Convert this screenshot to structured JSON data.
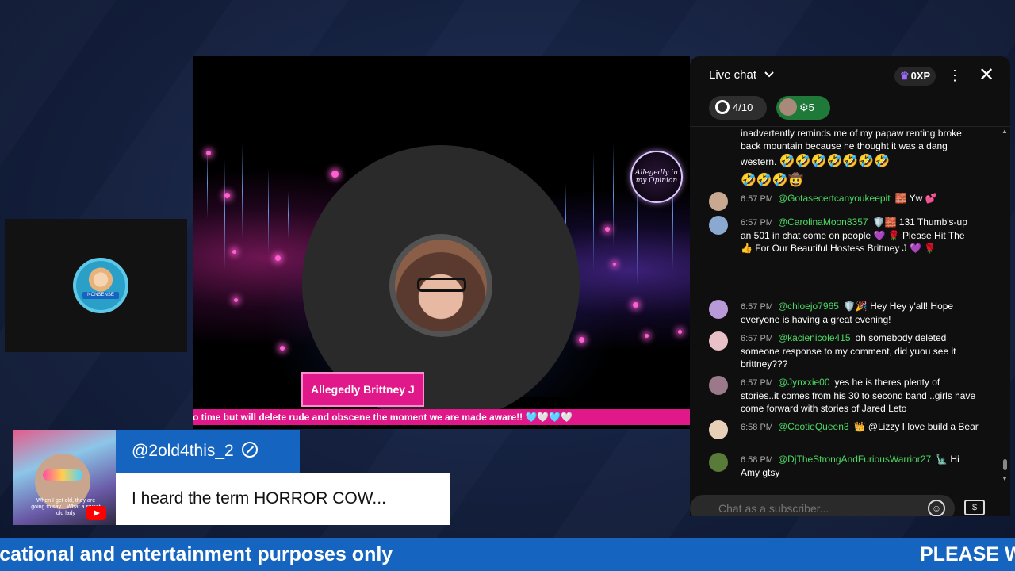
{
  "guest": {
    "avatar_label": "NONSENSE"
  },
  "stage": {
    "logo_text": "Allegedly in my Opinion",
    "host_name": "Allegedly Brittney J",
    "ticker": "o time but will delete rude and obscene the moment we are made aware!! 🩵🤍🩵🤍"
  },
  "chat": {
    "title": "Live chat",
    "xp": "0XP",
    "goal": "4/10",
    "gifts": "5",
    "input_placeholder": "Chat as a subscriber...",
    "continuation": {
      "text": "inadvertently reminds me of my papaw renting broke back mountain because he thought it was a dang western.",
      "emoji_line1": "🤣🤣🤣🤣🤣🤣🤣",
      "emoji_line2": "🤣🤣🤣🤠"
    },
    "messages": [
      {
        "time": "6:57 PM",
        "user": "@Gotasecertcanyoukeepit",
        "text": "🧱 Yw 💕",
        "avatar_color": "#c8a890"
      },
      {
        "time": "6:57 PM",
        "user": "@CarolinaMoon8357",
        "text": "🛡️🧱 131 Thumb's-up an 501 in chat come on people 💜 🌹 Please Hit The 👍 For Our Beautiful Hostess Brittney J 💜 🌹",
        "avatar_color": "#8aa8d0"
      },
      {
        "time": "6:57 PM",
        "user": "@chloejo7965",
        "text": "🛡️🎉 Hey Hey y'all! Hope everyone is having a great evening!",
        "avatar_color": "#b89ad8"
      },
      {
        "time": "6:57 PM",
        "user": "@kacienicole415",
        "text": "oh somebody deleted someone response to my comment, did yuou see it brittney???",
        "avatar_color": "#e8c0c8"
      },
      {
        "time": "6:57 PM",
        "user": "@Jynxxie00",
        "text": "yes he is theres plenty of stories..it comes from his 30 to second band ..girls have come forward with stories of Jared Leto",
        "avatar_color": "#9a7a8a"
      },
      {
        "time": "6:58 PM",
        "user": "@CootieQueen3",
        "text": "👑 @Lizzy I love build a Bear",
        "avatar_color": "#e8d0b8"
      },
      {
        "time": "6:58 PM",
        "user": "@DjTheStrongAndFuriousWarrior27",
        "text": "🗽 Hi Amy gtsy",
        "avatar_color": "#5a7a3a"
      }
    ],
    "colors": {
      "username": "#4cd964",
      "panel": "#0f0f0f"
    }
  },
  "featured": {
    "username": "@2old4this_2",
    "comment": "I heard the term HORROR COW...",
    "avatar_caption": "When I get old, they are going to say... What a sweet old lady"
  },
  "banner": {
    "left_text": "ucational and entertainment purposes only",
    "right_text": "PLEASE W"
  }
}
